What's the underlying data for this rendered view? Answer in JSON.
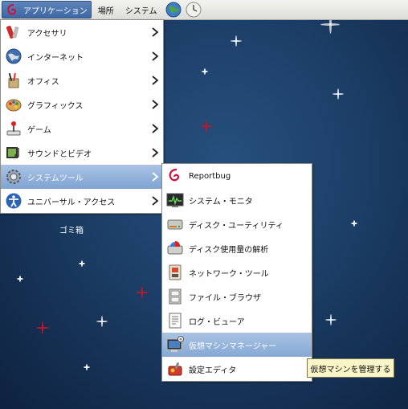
{
  "panel": {
    "applications_label": "アプリケーション",
    "places_label": "場所",
    "system_label": "システム"
  },
  "menu": {
    "items": [
      {
        "label": "アクセサリ",
        "icon": "accessories-icon"
      },
      {
        "label": "インターネット",
        "icon": "internet-globe-icon"
      },
      {
        "label": "オフィス",
        "icon": "office-icon"
      },
      {
        "label": "グラフィックス",
        "icon": "graphics-palette-icon"
      },
      {
        "label": "ゲーム",
        "icon": "games-joystick-icon"
      },
      {
        "label": "サウンドとビデオ",
        "icon": "sound-video-icon"
      },
      {
        "label": "システムツール",
        "icon": "system-tools-gear-icon"
      },
      {
        "label": "ユニバーサル・アクセス",
        "icon": "universal-access-icon"
      }
    ]
  },
  "submenu": {
    "items": [
      {
        "label": "Reportbug",
        "icon": "debian-swirl-icon"
      },
      {
        "label": "システム・モニタ",
        "icon": "system-monitor-icon"
      },
      {
        "label": "ディスク・ユーティリティ",
        "icon": "disk-utility-icon"
      },
      {
        "label": "ディスク使用量の解析",
        "icon": "disk-usage-icon"
      },
      {
        "label": "ネットワーク・ツール",
        "icon": "network-tools-icon"
      },
      {
        "label": "ファイル・ブラウザ",
        "icon": "file-browser-icon"
      },
      {
        "label": "ログ・ビューア",
        "icon": "log-viewer-icon"
      },
      {
        "label": "仮想マシンマネージャー",
        "icon": "virtual-machine-manager-icon"
      },
      {
        "label": "設定エディタ",
        "icon": "configuration-editor-icon"
      }
    ]
  },
  "desktop": {
    "trash_label_partial": "ゴミ箱"
  },
  "tooltip": {
    "text": "仮想マシンを管理する"
  },
  "colors": {
    "highlight": "#7fa3d2",
    "panel": "#dcdcd8",
    "desktop": "#1d4069",
    "accent_red": "#c0182a"
  }
}
